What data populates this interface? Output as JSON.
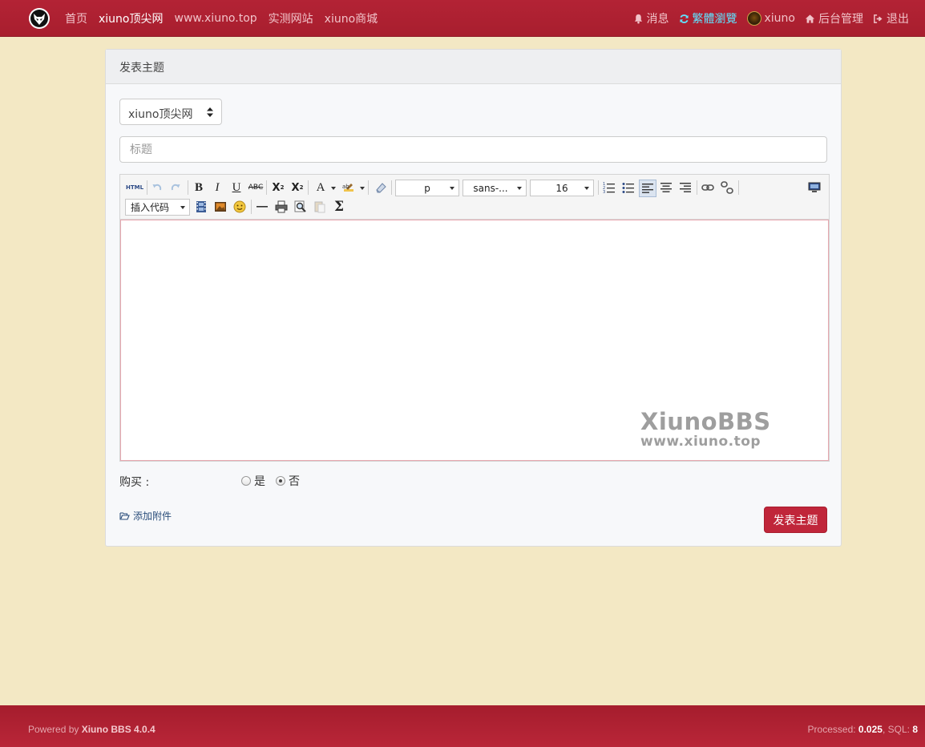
{
  "navbar": {
    "logo_icon": "xiuno-logo-icon",
    "links": [
      {
        "label": "首页",
        "active": false
      },
      {
        "label": "xiuno顶尖网",
        "active": true
      },
      {
        "label": "www.xiuno.top",
        "active": false
      },
      {
        "label": "实测网站",
        "active": false
      },
      {
        "label": "xiuno商城",
        "active": false
      }
    ],
    "right": {
      "messages": "消息",
      "traditional": "繁體瀏覽",
      "username": "xiuno",
      "admin": "后台管理",
      "logout": "退出"
    }
  },
  "card": {
    "header": "发表主题",
    "forum_select": "xiuno顶尖网",
    "title_placeholder": "标题",
    "editor": {
      "html_label": "HTML",
      "format_value": "p",
      "font_value": "sans-...",
      "size_value": "16",
      "insert_code": "插入代码",
      "watermark_line1": "XiunoBBS",
      "watermark_line2": "www.xiuno.top"
    },
    "purchase": {
      "label": "购买 :",
      "yes": "是",
      "no": "否",
      "selected": "否"
    },
    "attach_label": "添加附件",
    "submit_label": "发表主题"
  },
  "footer": {
    "powered_prefix": "Powered by ",
    "powered_brand": "Xiuno BBS 4.0.4",
    "processed_prefix": "Processed: ",
    "processed_value": "0.025",
    "sql_prefix": ", SQL: ",
    "sql_value": "8"
  },
  "colors": {
    "nav_bg": "#b32335",
    "page_bg": "#f3e8c4",
    "submit_bg": "#c0263a",
    "traditional_link": "#5fe3ff"
  }
}
